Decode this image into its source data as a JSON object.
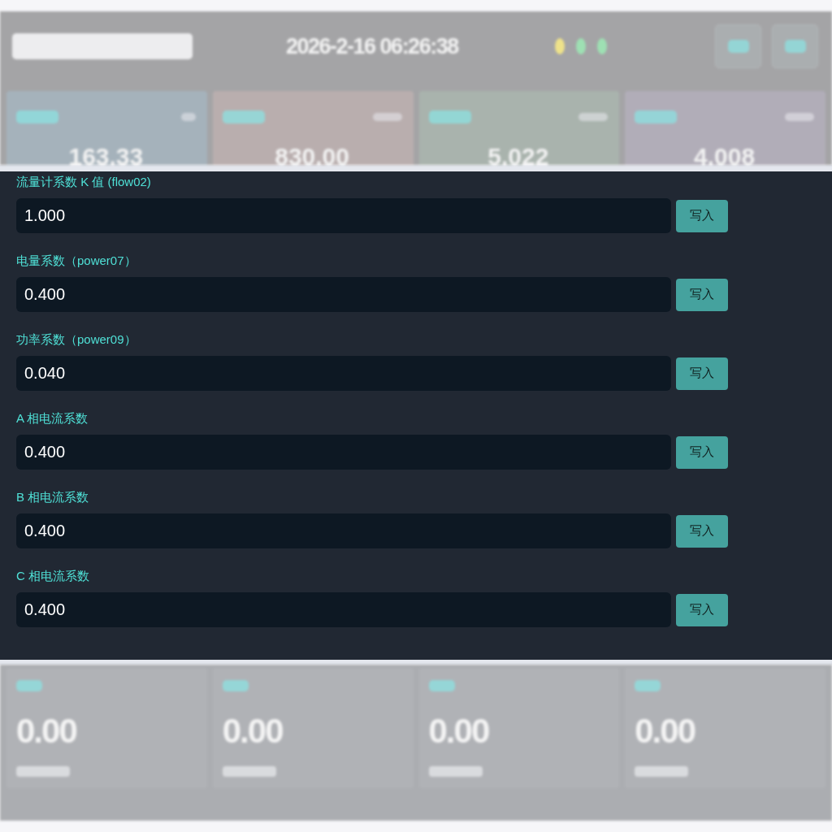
{
  "header": {
    "time": "2026-2-16 06:26:38",
    "status_dots": [
      {
        "color": "#eee28a"
      },
      {
        "color": "#9ee0b3"
      },
      {
        "color": "#9ee0b3"
      }
    ]
  },
  "stat_cards": [
    {
      "value": "163.33",
      "color": "#a5b2bb"
    },
    {
      "value": "830.00",
      "color": "#b9aeae"
    },
    {
      "value": "5.022",
      "color": "#a9b3ad"
    },
    {
      "value": "4.008",
      "color": "#b1adb8"
    }
  ],
  "coefficient_form": {
    "fields": [
      {
        "label": "流量计系数 K 值 (flow02)",
        "value": "1.000",
        "button": "写入"
      },
      {
        "label": "电量系数（power07）",
        "value": "0.400",
        "button": "写入"
      },
      {
        "label": "功率系数（power09）",
        "value": "0.040",
        "button": "写入"
      },
      {
        "label": "A 相电流系数",
        "value": "0.400",
        "button": "写入"
      },
      {
        "label": "B 相电流系数",
        "value": "0.400",
        "button": "写入"
      },
      {
        "label": "C 相电流系数",
        "value": "0.400",
        "button": "写入"
      }
    ]
  },
  "meter_cards": [
    {
      "value": "0.00"
    },
    {
      "value": "0.00"
    },
    {
      "value": "0.00"
    },
    {
      "value": "0.00"
    }
  ]
}
